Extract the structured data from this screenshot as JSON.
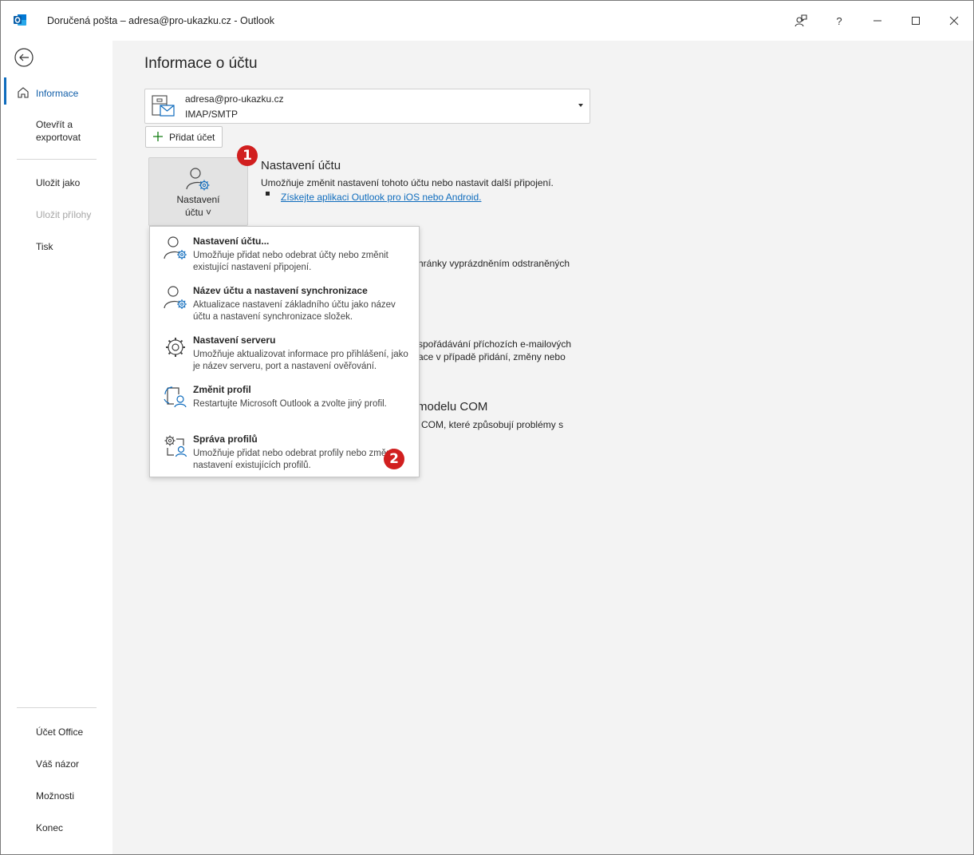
{
  "window": {
    "title": "Doručená pošta – adresa@pro-ukazku.cz  -  Outlook",
    "help_label": "?"
  },
  "sidebar": {
    "items": [
      {
        "label": "Informace",
        "active": true
      },
      {
        "label": "Otevřít a exportovat"
      },
      {
        "label": "Uložit jako"
      },
      {
        "label": "Uložit přílohy",
        "disabled": true
      },
      {
        "label": "Tisk"
      }
    ],
    "bottom_items": [
      {
        "label": "Účet Office"
      },
      {
        "label": "Váš názor"
      },
      {
        "label": "Možnosti"
      },
      {
        "label": "Konec"
      }
    ]
  },
  "main": {
    "page_title": "Informace o účtu",
    "account": {
      "email": "adresa@pro-ukazku.cz",
      "type": "IMAP/SMTP"
    },
    "add_account_label": "Přidat účet",
    "account_settings_button": {
      "line1": "Nastavení",
      "line2": "účtu ˅"
    },
    "sections": [
      {
        "title": "Nastavení účtu",
        "desc": "Umožňuje změnit nastavení tohoto účtu nebo nastavit další připojení.",
        "link": "Získejte aplikaci Outlook pro iOS nebo Android."
      },
      {
        "partial_desc": "hránky vyprázdněním odstraněných"
      },
      {
        "partial_desc_1": "spořádávání příchozích e-mailových",
        "partial_desc_2": "ace v případě přidání, změny nebo"
      },
      {
        "partial_title": "modelu COM",
        "partial_desc": "COM, které způsobují problémy s"
      }
    ]
  },
  "dropdown": {
    "items": [
      {
        "title": "Nastavení účtu...",
        "desc": "Umožňuje přidat nebo odebrat účty nebo změnit existující nastavení připojení.",
        "icon": "person-gear-icon"
      },
      {
        "title": "Název účtu a nastavení synchronizace",
        "desc": "Aktualizace nastavení základního účtu jako název účtu a nastavení synchronizace složek.",
        "icon": "person-gear-icon"
      },
      {
        "title": "Nastavení serveru",
        "desc": "Umožňuje aktualizovat informace pro přihlášení, jako je název serveru, port a nastavení ověřování.",
        "icon": "gear-icon"
      },
      {
        "title": "Změnit profil",
        "desc": "Restartujte Microsoft Outlook a zvolte jiný profil.",
        "icon": "change-profile-icon"
      },
      {
        "title": "Správa profilů",
        "desc": "Umožňuje přidat nebo odebrat profily nebo změnit nastavení existujících profilů.",
        "icon": "manage-profiles-icon"
      }
    ]
  },
  "badges": [
    "1",
    "2"
  ],
  "colors": {
    "accent": "#0f6cbd",
    "badge": "#d11f1f"
  }
}
